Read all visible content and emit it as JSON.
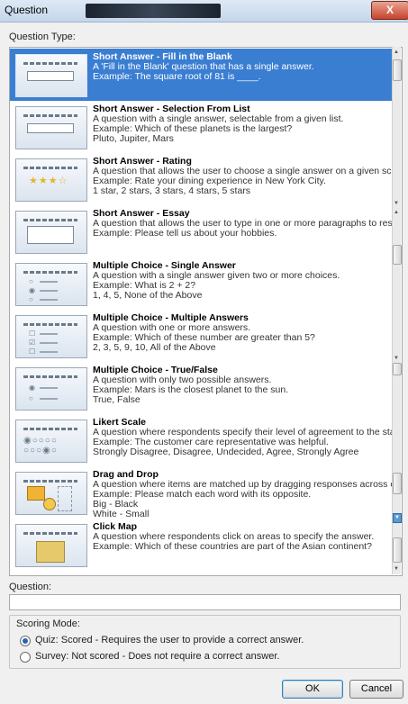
{
  "window": {
    "title": "Question",
    "close_label": "X"
  },
  "question_type_label": "Question Type:",
  "items": [
    {
      "title": "Short Answer - Fill in the Blank",
      "lines": [
        "A 'Fill in the Blank' question that has a single answer.",
        "Example: The square root of 81 is ____."
      ],
      "selected": true,
      "thumb": "blank"
    },
    {
      "title": "Short Answer - Selection From List",
      "lines": [
        "A question with a single answer, selectable from a given list.",
        "Example: Which of these planets is the largest?",
        "Pluto, Jupiter, Mars"
      ],
      "selected": false,
      "thumb": "list"
    },
    {
      "title": "Short Answer - Rating",
      "lines": [
        "A question that allows the user to choose a single answer on a given scale.",
        "Example: Rate your dining experience in New York City.",
        "1 star, 2 stars, 3 stars, 4 stars, 5 stars"
      ],
      "selected": false,
      "thumb": "rating"
    },
    {
      "title": "Short Answer - Essay",
      "lines": [
        "A question that allows the user to type in one or more paragraphs to respond.",
        "Example: Please tell us about your hobbies."
      ],
      "selected": false,
      "thumb": "essay"
    },
    {
      "title": "Multiple Choice - Single Answer",
      "lines": [
        "A question with a single answer given two or more choices.",
        "Example: What is 2 + 2?",
        "1, 4, 5, None of the Above"
      ],
      "selected": false,
      "thumb": "single"
    },
    {
      "title": "Multiple Choice - Multiple Answers",
      "lines": [
        "A question with one or more answers.",
        "Example: Which of these number are greater than 5?",
        "2, 3, 5, 9, 10, All of the Above"
      ],
      "selected": false,
      "thumb": "multi"
    },
    {
      "title": "Multiple Choice - True/False",
      "lines": [
        "A question with only two possible answers.",
        "Example: Mars is the closest planet to the sun.",
        "True, False"
      ],
      "selected": false,
      "thumb": "tf"
    },
    {
      "title": "Likert Scale",
      "lines": [
        "A question where respondents specify their level of agreement to the statement.",
        "Example: The customer care representative was helpful.",
        "Strongly Disagree, Disagree, Undecided, Agree, Strongly Agree"
      ],
      "selected": false,
      "thumb": "likert"
    },
    {
      "title": "Drag and Drop",
      "lines": [
        "A question where items are matched up by dragging responses across columns.",
        "Example: Please match each word with its opposite.",
        "Big - Black",
        "White - Small"
      ],
      "selected": false,
      "thumb": "dnd"
    },
    {
      "title": "Click Map",
      "lines": [
        "A question where respondents click on areas to specify the answer.",
        "Example: Which of these countries are part of the Asian continent?"
      ],
      "selected": false,
      "thumb": "map"
    }
  ],
  "question_label": "Question:",
  "question_value": "",
  "scoring": {
    "label": "Scoring Mode:",
    "quiz": "Quiz: Scored - Requires the user to provide a correct answer.",
    "survey": "Survey: Not scored - Does not require a correct answer.",
    "selected": "quiz"
  },
  "buttons": {
    "ok": "OK",
    "cancel": "Cancel"
  }
}
